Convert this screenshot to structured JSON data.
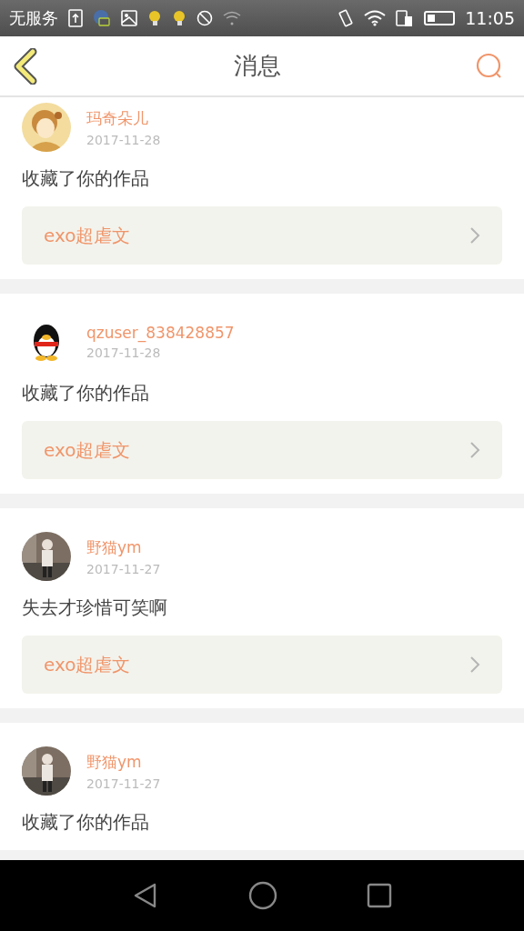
{
  "status_bar": {
    "carrier": "无服务",
    "time": "11:05"
  },
  "header": {
    "title": "消息"
  },
  "messages": [
    {
      "user": "玛奇朵儿",
      "date": "2017-11-28",
      "text": "收藏了你的作品",
      "work": "exo超虐文"
    },
    {
      "user": "qzuser_838428857",
      "date": "2017-11-28",
      "text": "收藏了你的作品",
      "work": "exo超虐文"
    },
    {
      "user": "野猫ym",
      "date": "2017-11-27",
      "text": "失去才珍惜可笑啊",
      "work": "exo超虐文"
    },
    {
      "user": "野猫ym",
      "date": "2017-11-27",
      "text": "收藏了你的作品"
    }
  ]
}
